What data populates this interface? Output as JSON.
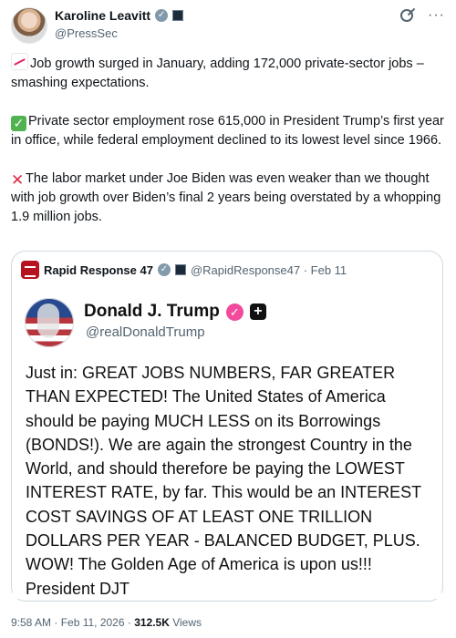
{
  "post": {
    "author_name": "Karoline Leavitt",
    "author_handle": "@PressSec",
    "paragraphs": [
      "Job growth surged in January, adding 172,000 private-sector jobs – smashing expectations.",
      "Private sector employment rose 615,000 in President Trump’s first year in office, while federal employment declined to its lowest level since 1966.",
      "The labor market under Joe Biden was even weaker than we thought with job growth over Biden’s final 2 years being overstated by a whopping 1.9 million jobs."
    ],
    "footer": {
      "timestamp": "9:58 AM · Feb 11, 2026 · ",
      "views_count": "312.5K",
      "views_label": " Views"
    }
  },
  "quote": {
    "name": "Rapid Response 47",
    "handle_and_date": "@RapidResponse47 · Feb 11",
    "inner_post": {
      "name": "Donald J. Trump",
      "handle": "@realDonaldTrump",
      "text": "Just in: GREAT JOBS NUMBERS, FAR GREATER THAN EXPECTED! The United States of America should be paying MUCH LESS on its Borrowings (BONDS!). We are again the strongest Country in the World, and should therefore be paying the LOWEST INTEREST RATE, by far. This would be an INTEREST COST SAVINGS OF AT LEAST ONE TRILLION DOLLARS PER YEAR - BALANCED BUDGET, PLUS. WOW! The Golden Age of America is upon us!!! President DJT"
    }
  },
  "icons": {
    "verified": "verified-badge-icon",
    "government": "government-badge-icon",
    "grok": "grok-icon",
    "more": "more-icon",
    "chart_emoji": "chart-increasing-emoji",
    "check_emoji": "check-mark-emoji",
    "cross_emoji": "cross-mark-emoji"
  }
}
